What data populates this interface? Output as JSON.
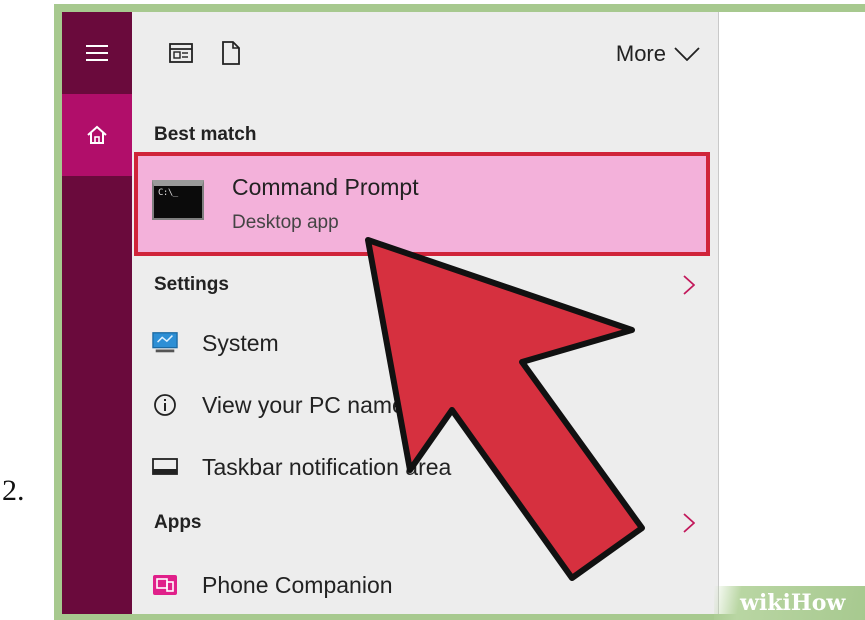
{
  "step_number": "2.",
  "toolbar": {
    "more_label": "More"
  },
  "best_match": {
    "section_label": "Best match",
    "title": "Command Prompt",
    "subtitle": "Desktop app",
    "icon_text": "C:\\_"
  },
  "settings": {
    "section_label": "Settings",
    "items": [
      {
        "label": "System",
        "icon": "monitor-icon"
      },
      {
        "label": "View your PC name",
        "icon": "info-icon"
      },
      {
        "label": "Taskbar notification area",
        "icon": "taskbar-icon"
      }
    ]
  },
  "apps": {
    "section_label": "Apps",
    "items": [
      {
        "label": "Phone Companion",
        "icon": "phone-companion-icon"
      }
    ]
  },
  "watermark": {
    "wiki": "wiki",
    "how": "How"
  },
  "colors": {
    "rail": "#6a0a3c",
    "rail_active": "#b10e6a",
    "highlight_fill": "#f3b1da",
    "highlight_border": "#d0243a",
    "arrow": "#d6303f",
    "frame": "#a7c98f"
  }
}
